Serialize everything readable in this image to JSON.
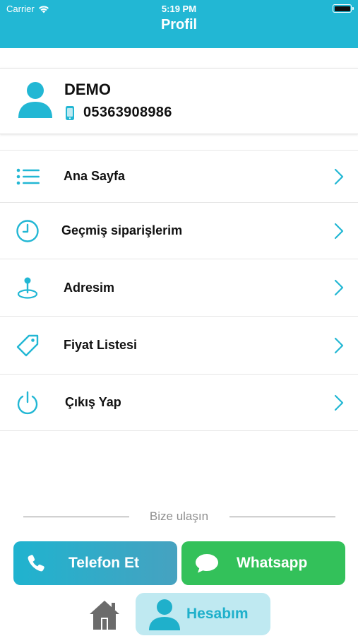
{
  "status_bar": {
    "carrier": "Carrier",
    "time": "5:19 PM"
  },
  "header": {
    "title": "Profil"
  },
  "profile": {
    "name": "DEMO",
    "phone": "05363908986"
  },
  "menu": {
    "items": [
      {
        "label": "Ana Sayfa",
        "icon": "list-icon"
      },
      {
        "label": "Geçmiş siparişlerim",
        "icon": "clock-icon"
      },
      {
        "label": "Adresim",
        "icon": "location-pin-icon"
      },
      {
        "label": "Fiyat Listesi",
        "icon": "price-tag-icon"
      },
      {
        "label": "Çıkış Yap",
        "icon": "power-icon"
      }
    ]
  },
  "contact": {
    "heading": "Bize ulaşın",
    "phone_button": "Telefon Et",
    "whatsapp_button": "Whatsapp"
  },
  "tabbar": {
    "account_label": "Hesabım"
  },
  "colors": {
    "accent": "#22b7d4",
    "whatsapp": "#33c15a",
    "tab_active_bg": "#bfe9f1",
    "muted_text": "#8f8f8f"
  }
}
